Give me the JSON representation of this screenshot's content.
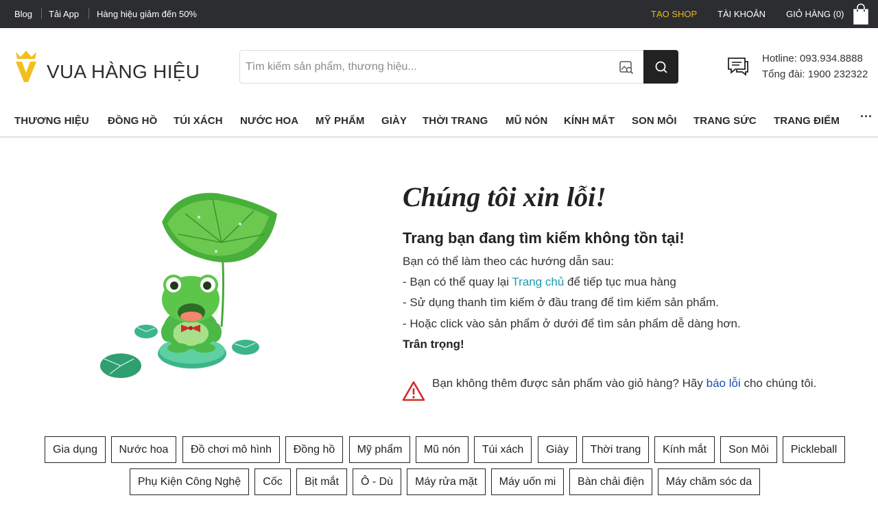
{
  "topbar": {
    "blog": "Blog",
    "app": "Tải App",
    "promo": "Hàng hiệu giảm đến 50%",
    "create_shop": "TẠO SHOP",
    "account": "TÀI KHOẢN",
    "cart": "GIỎ HÀNG (0)"
  },
  "header": {
    "logo_text": "VUA HÀNG HIỆU",
    "search_placeholder": "Tìm kiếm sản phẩm, thương hiệu...",
    "hotline": "Hotline: 093.934.8888",
    "switchboard": "Tổng đài: 1900 232322"
  },
  "nav": {
    "items": [
      "THƯƠNG HIỆU",
      "ĐỒNG HỒ",
      "TÚI XÁCH",
      "NƯỚC HOA",
      "MỸ PHẨM",
      "GIÀY",
      "THỜI TRANG",
      "MŨ NÓN",
      "KÍNH MẮT",
      "SON MÔI",
      "TRANG SỨC",
      "TRANG ĐIỂM"
    ],
    "more": "···"
  },
  "error": {
    "title": "Chúng tôi xin lỗi!",
    "subtitle": "Trang bạn đang tìm kiếm không tồn tại!",
    "intro": "Bạn có thể làm theo các hướng dẫn sau:",
    "step1_before": "- Bạn có thể quay lại ",
    "step1_link": "Trang chủ",
    "step1_after": " để tiếp tục mua hàng",
    "step2": "- Sử dụng thanh tìm kiếm ở đầu trang để tìm kiếm sản phẩm.",
    "step3": "- Hoặc click vào sản phẩm ở dưới để tìm sản phẩm dễ dàng hơn.",
    "regards": "Trân trọng!",
    "report_before": "Bạn không thêm được sản phẩm vào giỏ hàng? Hãy ",
    "report_link": "báo lỗi",
    "report_after": " cho chúng tôi."
  },
  "categories": {
    "row1": [
      "Gia dụng",
      "Nước hoa",
      "Đồ chơi mô hình",
      "Đồng hồ",
      "Mỹ phẩm",
      "Mũ nón",
      "Túi xách",
      "Giày",
      "Thời trang",
      "Kính mắt",
      "Son Môi",
      "Pickleball"
    ],
    "row2": [
      "Phụ Kiện Công Nghệ",
      "Cốc",
      "Bịt mắt",
      "Ô - Dù",
      "Máy rửa mặt",
      "Máy uốn mi",
      "Bàn chải điện",
      "Máy chăm sóc da"
    ]
  },
  "colors": {
    "topbar_bg": "#2b2d31",
    "shop_accent": "#e8b923",
    "logo_gold": "#f2c01e",
    "link_teal": "#1a9bb0",
    "link_blue": "#1a4fb0",
    "warning_red": "#d42a2a"
  }
}
